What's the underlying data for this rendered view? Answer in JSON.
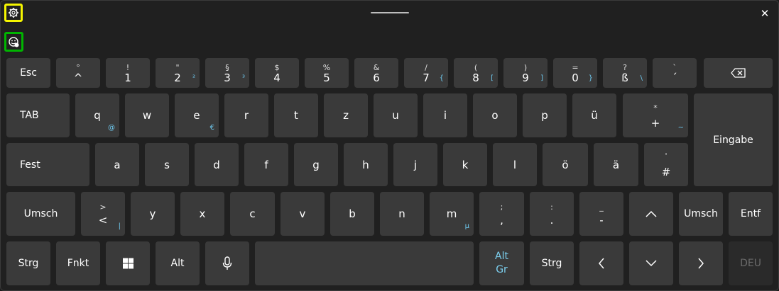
{
  "window": {
    "close_glyph": "✕"
  },
  "toolbar": {
    "settings_icon": "gear-icon",
    "emoji_icon": "emoji-icon"
  },
  "row1": {
    "esc": "Esc",
    "k_circ": {
      "shift": "°",
      "main": "^"
    },
    "k1": {
      "shift": "!",
      "main": "1"
    },
    "k2": {
      "shift": "\"",
      "main": "2",
      "alt": "²"
    },
    "k3": {
      "shift": "§",
      "main": "3",
      "alt": "³"
    },
    "k4": {
      "shift": "$",
      "main": "4"
    },
    "k5": {
      "shift": "%",
      "main": "5"
    },
    "k6": {
      "shift": "&",
      "main": "6"
    },
    "k7": {
      "shift": "/",
      "main": "7",
      "alt": "{"
    },
    "k8": {
      "shift": "(",
      "main": "8",
      "alt": "["
    },
    "k9": {
      "shift": ")",
      "main": "9",
      "alt": "]"
    },
    "k0": {
      "shift": "=",
      "main": "0",
      "alt": "}"
    },
    "ksz": {
      "shift": "?",
      "main": "ß",
      "alt": "\\"
    },
    "kacc": {
      "shift": "`",
      "main": "´"
    }
  },
  "row2": {
    "tab": "TAB",
    "q": {
      "main": "q",
      "alt": "@"
    },
    "w": "w",
    "e": {
      "main": "e",
      "alt": "€"
    },
    "r": "r",
    "t": "t",
    "z": "z",
    "u": "u",
    "i": "i",
    "o": "o",
    "p": "p",
    "ue": "ü",
    "plus": {
      "shift": "*",
      "main": "+",
      "alt": "~"
    },
    "enter": "Eingabe"
  },
  "row3": {
    "caps": "Fest",
    "a": "a",
    "s": "s",
    "d": "d",
    "f": "f",
    "g": "g",
    "h": "h",
    "j": "j",
    "k": "k",
    "l": "l",
    "oe": "ö",
    "ae": "ä",
    "hash": {
      "shift": "'",
      "main": "#"
    }
  },
  "row4": {
    "lshift": "Umsch",
    "lt": {
      "shift": ">",
      "main": "<",
      "alt": "|"
    },
    "y": "y",
    "x": "x",
    "c": "c",
    "v": "v",
    "b": "b",
    "n": "n",
    "m": {
      "main": "m",
      "alt": "µ"
    },
    "comma": {
      "shift": ";",
      "main": ","
    },
    "period": {
      "shift": ":",
      "main": "."
    },
    "minus": {
      "shift": "_",
      "main": "-"
    },
    "rshift": "Umsch",
    "del": "Entf"
  },
  "row5": {
    "ctrl": "Strg",
    "fn": "Fnkt",
    "alt": "Alt",
    "altgr_line1": "Alt",
    "altgr_line2": "Gr",
    "rctrl": "Strg",
    "lang": "DEU"
  },
  "colors": {
    "background": "#202020",
    "key": "#3a3a3a",
    "accent_blue": "#6ec8ee",
    "settings_highlight": "#f5f500",
    "emoji_highlight": "#00b400"
  }
}
